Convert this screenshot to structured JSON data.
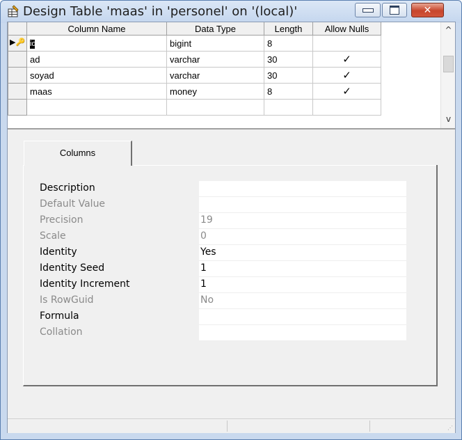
{
  "window": {
    "title": "Design Table 'maas' in 'personel' on '(local)'",
    "accent_color": "#c9d9ee",
    "close_color": "#c7452c",
    "buttons": {
      "minimize": "minimize-icon",
      "maximize": "maximize-icon",
      "close": "✕"
    }
  },
  "grid": {
    "columns": [
      "Column Name",
      "Data Type",
      "Length",
      "Allow Nulls"
    ],
    "rows": [
      {
        "name": "id",
        "type": "bigint",
        "length": "8",
        "nulls": "",
        "primary_key": true
      },
      {
        "name": "ad",
        "type": "varchar",
        "length": "30",
        "nulls": "✓"
      },
      {
        "name": "soyad",
        "type": "varchar",
        "length": "30",
        "nulls": "✓"
      },
      {
        "name": "maas",
        "type": "money",
        "length": "8",
        "nulls": "✓"
      }
    ],
    "scroll_up": "^",
    "scroll_down": "v"
  },
  "properties": {
    "tab_label": "Columns",
    "rows": [
      {
        "label": "Description",
        "value": "",
        "enabled": true
      },
      {
        "label": "Default Value",
        "value": "",
        "enabled": false
      },
      {
        "label": "Precision",
        "value": "19",
        "enabled": false
      },
      {
        "label": "Scale",
        "value": "0",
        "enabled": false
      },
      {
        "label": "Identity",
        "value": "Yes",
        "enabled": true
      },
      {
        "label": "Identity Seed",
        "value": "1",
        "enabled": true
      },
      {
        "label": "Identity Increment",
        "value": "1",
        "enabled": true
      },
      {
        "label": "Is RowGuid",
        "value": "No",
        "enabled": false
      },
      {
        "label": "Formula",
        "value": "",
        "enabled": true
      },
      {
        "label": "Collation",
        "value": "",
        "enabled": false
      }
    ]
  }
}
